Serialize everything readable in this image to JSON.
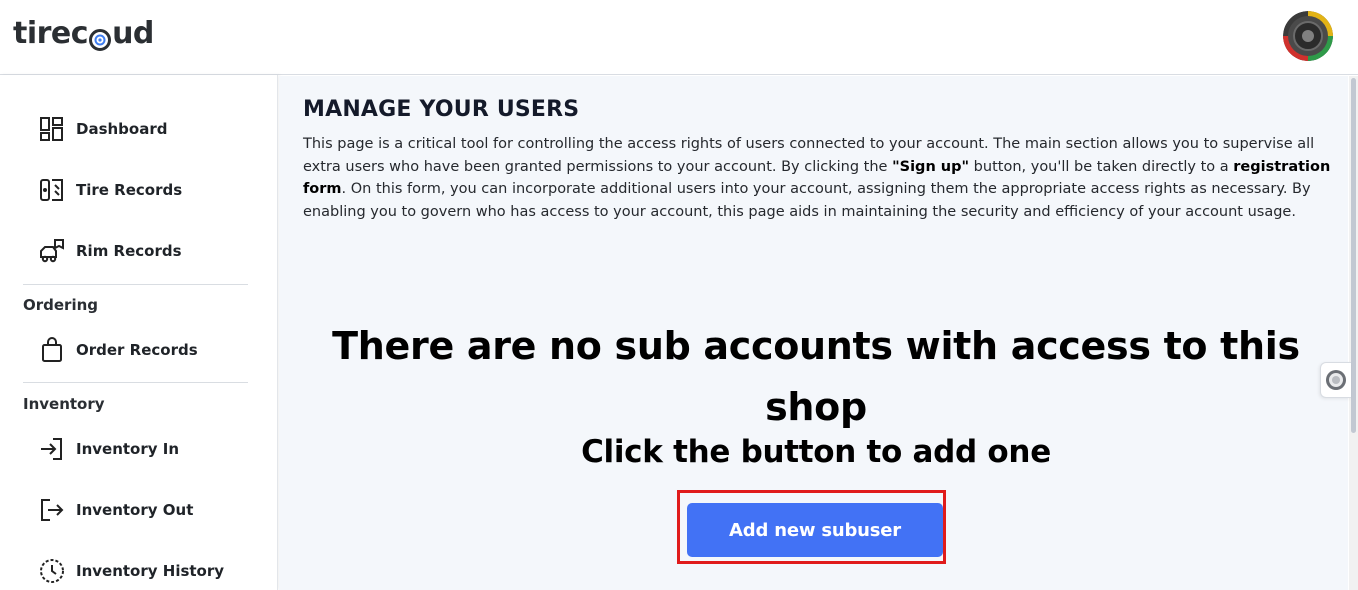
{
  "header": {
    "logo_text_left": "tirec",
    "logo_text_right": "ud",
    "avatar_alt": "user avatar"
  },
  "sidebar": {
    "items_top": [
      {
        "label": "Dashboard",
        "icon": "dashboard-icon"
      },
      {
        "label": "Tire Records",
        "icon": "tire-records-icon"
      },
      {
        "label": "Rim Records",
        "icon": "rim-records-icon"
      }
    ],
    "ordering_title": "Ordering",
    "ordering_items": [
      {
        "label": "Order Records",
        "icon": "shopping-bag-icon"
      }
    ],
    "inventory_title": "Inventory",
    "inventory_items": [
      {
        "label": "Inventory In",
        "icon": "login-arrow-icon"
      },
      {
        "label": "Inventory Out",
        "icon": "logout-arrow-icon"
      },
      {
        "label": "Inventory History",
        "icon": "history-clock-icon"
      }
    ]
  },
  "main": {
    "title": "MANAGE YOUR USERS",
    "description_1": "This page is a critical tool for controlling the access rights of users connected to your account. The main section allows you to supervise all extra users who have been granted permissions to your account. By clicking the ",
    "description_bold_1": "\"Sign up\"",
    "description_2": " button, you'll be taken directly to a ",
    "description_bold_2": "registration form",
    "description_3": ". On this form, you can incorporate additional users into your account, assigning them the appropriate access rights as necessary. By enabling you to govern who has access to your account, this page aids in maintaining the security and efficiency of your account usage.",
    "empty_title": "There are no sub accounts with access to this shop",
    "empty_subtitle": "Click the button to add one",
    "add_button_label": "Add new subuser"
  },
  "colors": {
    "accent": "#4272f5",
    "highlight": "#e01b1b",
    "main_bg": "#f4f7fb"
  }
}
